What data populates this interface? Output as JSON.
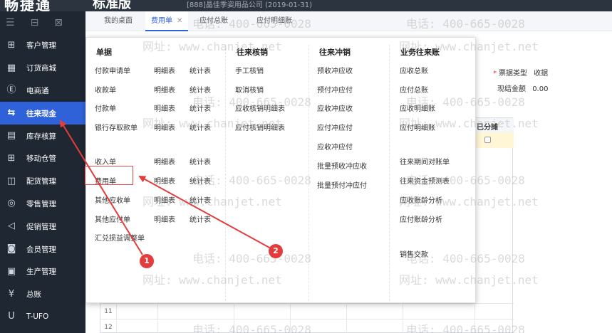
{
  "header": {
    "logo": "畅捷通",
    "edition": "标准版",
    "company": "[888]晶佳季姿用品公司 (2019-01-31)"
  },
  "sidebar": {
    "items": [
      {
        "label": "客户管理",
        "icon": "customer-icon"
      },
      {
        "label": "订货商城",
        "icon": "store-icon"
      },
      {
        "label": "电商通",
        "icon": "ecommerce-icon"
      },
      {
        "label": "往来现金",
        "icon": "transfer-icon",
        "active": true
      },
      {
        "label": "库存核算",
        "icon": "warehouse-icon"
      },
      {
        "label": "移动仓管",
        "icon": "mobile-warehouse-icon"
      },
      {
        "label": "配货管理",
        "icon": "distribution-icon"
      },
      {
        "label": "零售管理",
        "icon": "retail-icon"
      },
      {
        "label": "促销管理",
        "icon": "promotion-icon"
      },
      {
        "label": "会员管理",
        "icon": "member-icon"
      },
      {
        "label": "生产管理",
        "icon": "production-icon"
      },
      {
        "label": "总账",
        "icon": "ledger-icon"
      },
      {
        "label": "T-UFO",
        "icon": "ufo-icon"
      }
    ]
  },
  "tabs": [
    {
      "label": "我的桌面"
    },
    {
      "label": "费用单",
      "active": true
    },
    {
      "label": "应付总账"
    },
    {
      "label": "应付明细账"
    }
  ],
  "form": {
    "ticket_type_label": "票据类型",
    "ticket_type_value": "收据",
    "settle_amount_label": "现结金额",
    "settle_amount_value": "0.00",
    "allocated_header": "已分摊",
    "row_numbers": [
      "11",
      "12"
    ]
  },
  "menu": {
    "col1": {
      "head": "单据",
      "rows": [
        [
          "付款申请单",
          "明细表",
          "统计表"
        ],
        [
          "收款单",
          "明细表",
          "统计表"
        ],
        [
          "付款单",
          "明细表",
          "统计表"
        ],
        [
          "银行存取款单",
          "明细表",
          "统计表"
        ],
        [
          "收入单",
          "明细表",
          "统计表"
        ],
        [
          "费用单",
          "明细表",
          "统计表"
        ],
        [
          "其他应收单",
          "明细表",
          "统计表"
        ],
        [
          "其他应付单",
          "明细表",
          "统计表"
        ],
        [
          "汇兑损益调整单"
        ]
      ]
    },
    "col2": {
      "head": "往来核销",
      "items": [
        "手工核销",
        "取消核销",
        "应收核销明细表",
        "应付核销明细表"
      ]
    },
    "col3": {
      "head": "往来冲销",
      "items": [
        "预收冲应收",
        "预付冲应付",
        "应收冲应收",
        "应付冲应付",
        "应收冲应付",
        "批量预收冲应收",
        "批量预付冲应付"
      ]
    },
    "col4": {
      "head": "业务往来账",
      "items": [
        "应收总账",
        "应付总账",
        "应收明细账",
        "应付明细账",
        "往来期间对账单",
        "往来资金预测表",
        "应收账龄分析",
        "应付账龄分析",
        "销售交款"
      ]
    }
  },
  "annotations": {
    "badge1": "1",
    "badge2": "2"
  },
  "watermark": {
    "phone": "电话: 400-665-0028",
    "site": "网址: www.chanjet.net"
  },
  "colors": {
    "accent": "#2f62d9",
    "sidebar": "#1f2733",
    "annotation": "#e43c3c"
  }
}
